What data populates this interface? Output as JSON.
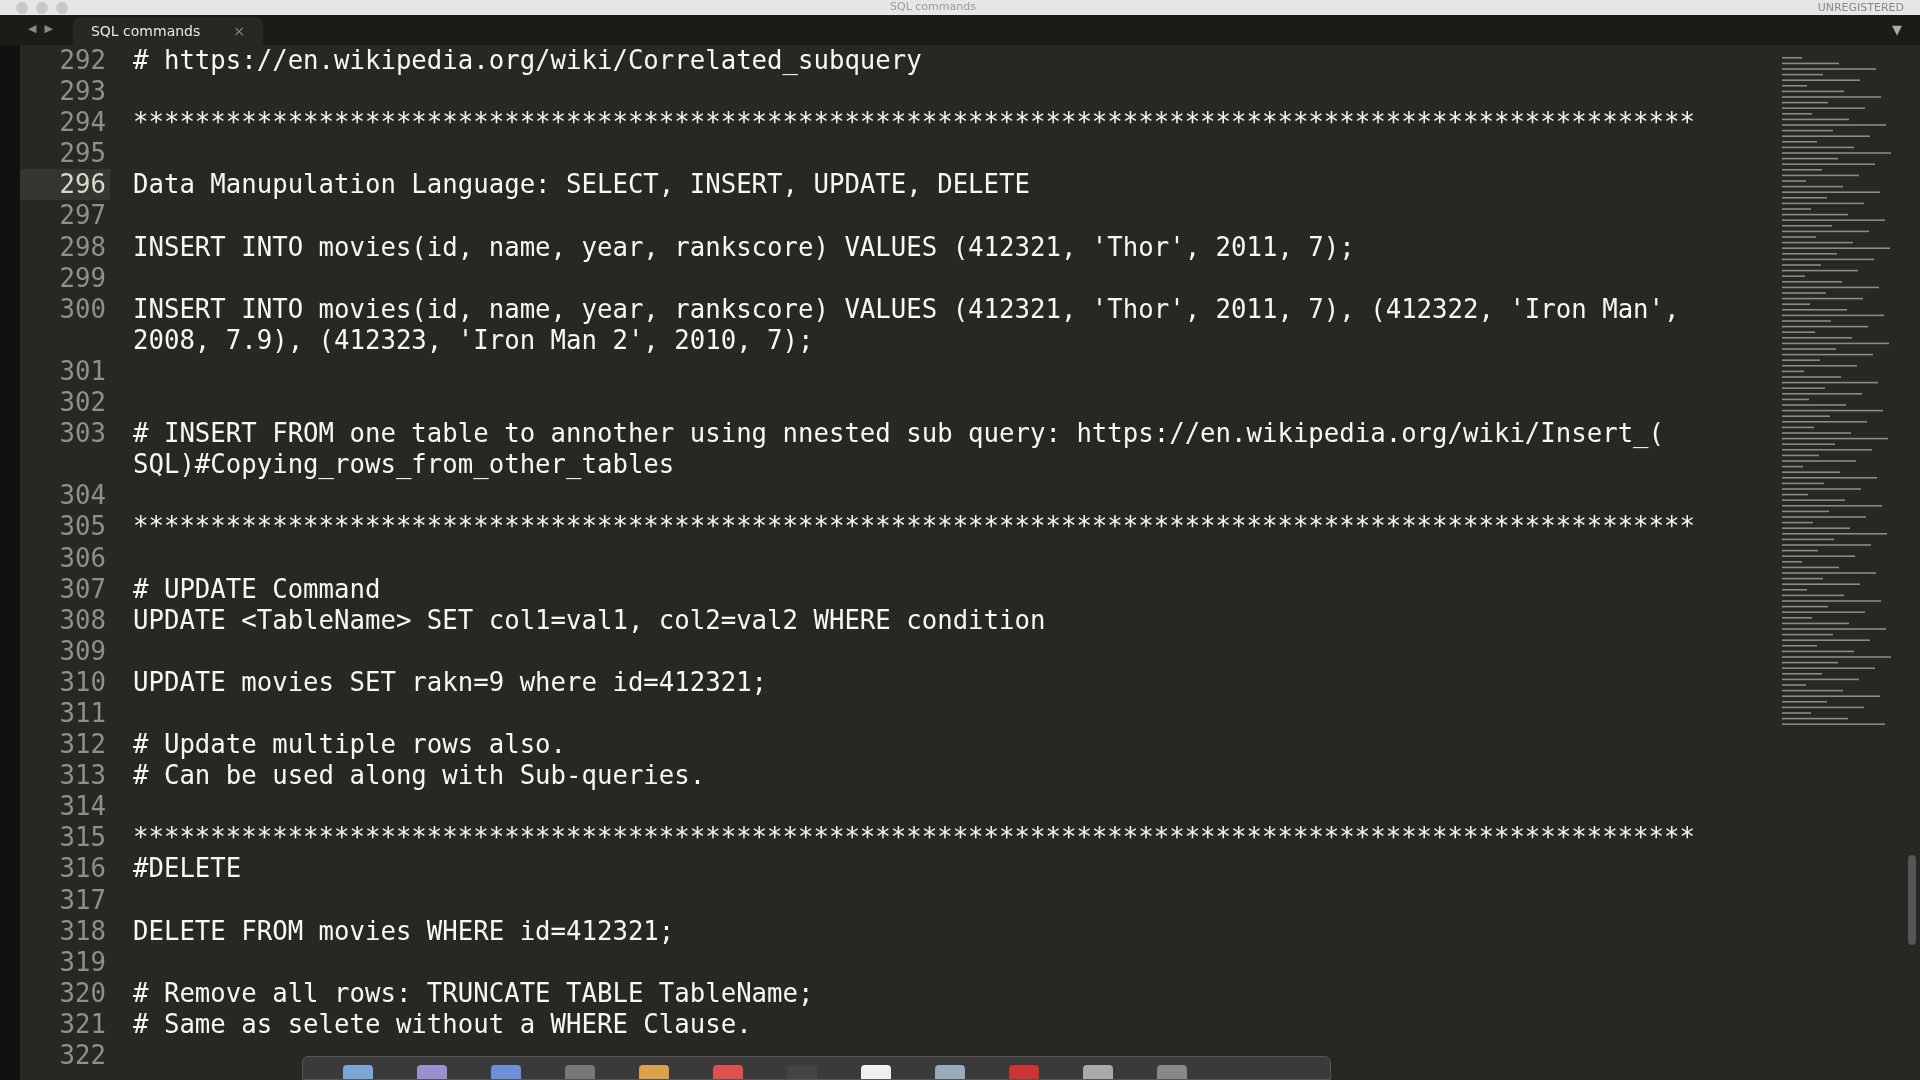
{
  "window": {
    "title": "SQL commands",
    "license": "UNREGISTERED"
  },
  "navigation": {
    "back": "◀",
    "forward": "▶",
    "menu": "▼"
  },
  "tabs": [
    {
      "label": "SQL commands",
      "selected": true,
      "close": "×"
    }
  ],
  "editor": {
    "lines": [
      {
        "number": "292",
        "rows": [
          "# https://en.wikipedia.org/wiki/Correlated_subquery"
        ],
        "selected": false
      },
      {
        "number": "293",
        "rows": [
          ""
        ],
        "selected": false
      },
      {
        "number": "294",
        "rows": [
          "*****************************************************************************************************"
        ],
        "selected": false
      },
      {
        "number": "295",
        "rows": [
          ""
        ],
        "selected": false
      },
      {
        "number": "296",
        "rows": [
          "Data Manupulation Language: SELECT, INSERT, UPDATE, DELETE"
        ],
        "selected": true
      },
      {
        "number": "297",
        "rows": [
          ""
        ],
        "selected": false
      },
      {
        "number": "298",
        "rows": [
          "INSERT INTO movies(id, name, year, rankscore) VALUES (412321, 'Thor', 2011, 7);"
        ],
        "selected": false
      },
      {
        "number": "299",
        "rows": [
          ""
        ],
        "selected": false
      },
      {
        "number": "300",
        "rows": [
          "INSERT INTO movies(id, name, year, rankscore) VALUES (412321, 'Thor', 2011, 7), (412322, 'Iron Man',",
          "2008, 7.9), (412323, 'Iron Man 2', 2010, 7);"
        ],
        "selected": false
      },
      {
        "number": "301",
        "rows": [
          ""
        ],
        "selected": false
      },
      {
        "number": "302",
        "rows": [
          ""
        ],
        "selected": false
      },
      {
        "number": "303",
        "rows": [
          "# INSERT FROM one table to annother using nnested sub query: https://en.wikipedia.org/wiki/Insert_(",
          "SQL)#Copying_rows_from_other_tables"
        ],
        "selected": false
      },
      {
        "number": "304",
        "rows": [
          ""
        ],
        "selected": false
      },
      {
        "number": "305",
        "rows": [
          "*****************************************************************************************************"
        ],
        "selected": false
      },
      {
        "number": "306",
        "rows": [
          ""
        ],
        "selected": false
      },
      {
        "number": "307",
        "rows": [
          "# UPDATE Command"
        ],
        "selected": false
      },
      {
        "number": "308",
        "rows": [
          "UPDATE <TableName> SET col1=val1, col2=val2 WHERE condition"
        ],
        "selected": false
      },
      {
        "number": "309",
        "rows": [
          ""
        ],
        "selected": false
      },
      {
        "number": "310",
        "rows": [
          "UPDATE movies SET rakn=9 where id=412321;"
        ],
        "selected": false
      },
      {
        "number": "311",
        "rows": [
          ""
        ],
        "selected": false
      },
      {
        "number": "312",
        "rows": [
          "# Update multiple rows also."
        ],
        "selected": false
      },
      {
        "number": "313",
        "rows": [
          "# Can be used along with Sub-queries."
        ],
        "selected": false
      },
      {
        "number": "314",
        "rows": [
          ""
        ],
        "selected": false
      },
      {
        "number": "315",
        "rows": [
          "*****************************************************************************************************"
        ],
        "selected": false
      },
      {
        "number": "316",
        "rows": [
          "#DELETE"
        ],
        "selected": false
      },
      {
        "number": "317",
        "rows": [
          ""
        ],
        "selected": false
      },
      {
        "number": "318",
        "rows": [
          "DELETE FROM movies WHERE id=412321;"
        ],
        "selected": false
      },
      {
        "number": "319",
        "rows": [
          ""
        ],
        "selected": false
      },
      {
        "number": "320",
        "rows": [
          "# Remove all rows: TRUNCATE TABLE TableName;"
        ],
        "selected": false
      },
      {
        "number": "321",
        "rows": [
          "# Same as selete without a WHERE Clause."
        ],
        "selected": false
      },
      {
        "number": "322",
        "rows": [
          ""
        ],
        "selected": false
      }
    ]
  }
}
